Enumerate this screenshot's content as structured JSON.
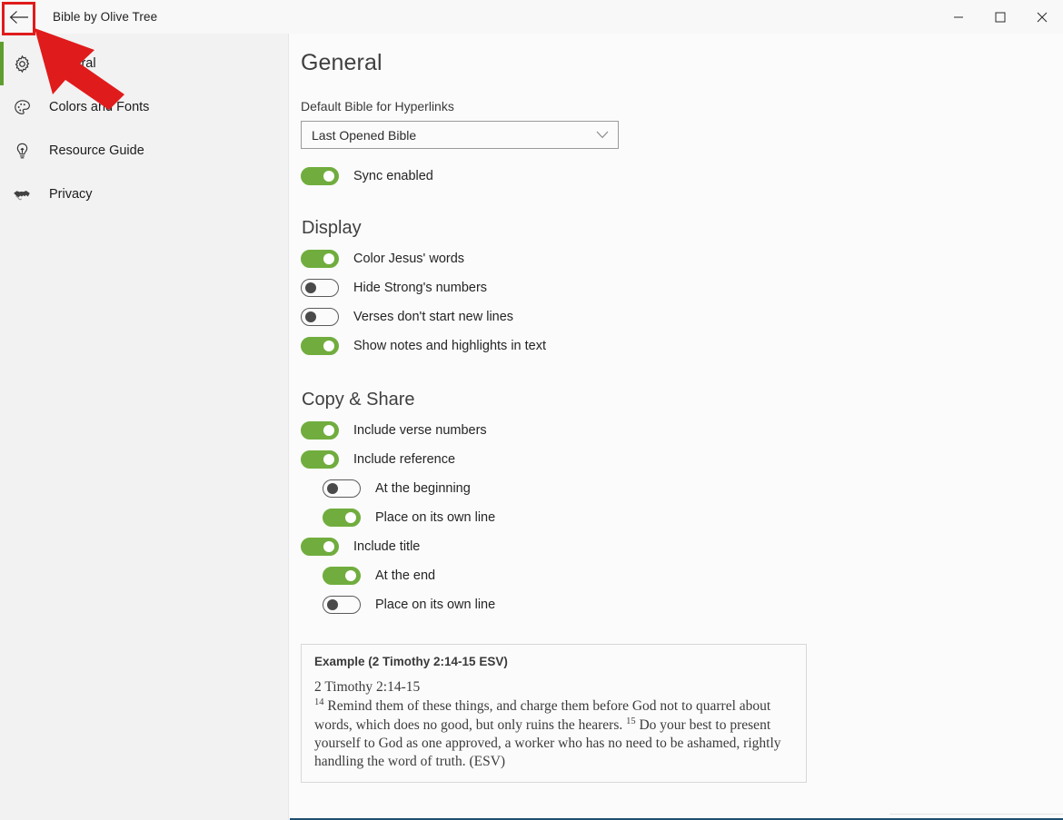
{
  "window": {
    "title": "Bible by Olive Tree",
    "back_icon": "back-arrow-icon",
    "minimize_label": "—",
    "maximize_label": "□",
    "close_label": "✕"
  },
  "sidebar": {
    "items": [
      {
        "label": "General",
        "icon": "gear-icon",
        "selected": true
      },
      {
        "label": "Colors and Fonts",
        "icon": "palette-icon",
        "selected": false
      },
      {
        "label": "Resource Guide",
        "icon": "lightbulb-icon",
        "selected": false
      },
      {
        "label": "Privacy",
        "icon": "handshake-icon",
        "selected": false
      }
    ],
    "selection_color": "#5f9e2e"
  },
  "main": {
    "page_title": "General",
    "default_bible": {
      "label": "Default Bible for Hyperlinks",
      "value": "Last Opened Bible",
      "chevron_icon": "chevron-down-icon"
    },
    "sync": {
      "label": "Sync enabled",
      "state": "on"
    },
    "display": {
      "title": "Display",
      "toggles": [
        {
          "label": "Color Jesus' words",
          "state": "on",
          "indent": false
        },
        {
          "label": "Hide Strong's numbers",
          "state": "off",
          "indent": false
        },
        {
          "label": "Verses don't start new lines",
          "state": "off",
          "indent": false
        },
        {
          "label": "Show notes and highlights in text",
          "state": "on",
          "indent": false
        }
      ]
    },
    "copy_share": {
      "title": "Copy & Share",
      "toggles": [
        {
          "label": "Include verse numbers",
          "state": "on",
          "indent": false
        },
        {
          "label": "Include reference",
          "state": "on",
          "indent": false
        },
        {
          "label": "At the beginning",
          "state": "off",
          "indent": true
        },
        {
          "label": "Place on its own line",
          "state": "on",
          "indent": true
        },
        {
          "label": "Include title",
          "state": "on",
          "indent": false
        },
        {
          "label": "At the end",
          "state": "on",
          "indent": true
        },
        {
          "label": "Place on its own line",
          "state": "off",
          "indent": true
        }
      ]
    },
    "example": {
      "heading": "Example (2 Timothy 2:14-15 ESV)",
      "reference": "2 Timothy 2:14-15",
      "verse_14_number": "14",
      "verse_14_text": "Remind them of these things, and charge them before God not to quarrel about words, which does no good, but only ruins the hearers.",
      "verse_15_number": "15",
      "verse_15_text": "Do your best to present yourself to God as one approved, a worker who has no need to be ashamed, rightly handling the word of truth. (ESV)"
    }
  },
  "annotation": {
    "highlight_color": "#e01b1b",
    "arrow_color": "#e01b1b",
    "target": "back-arrow-icon"
  },
  "colors": {
    "toggle_on": "#70ad3e",
    "sidebar_bg": "#f2f2f2",
    "content_bg": "#fbfbfb"
  }
}
